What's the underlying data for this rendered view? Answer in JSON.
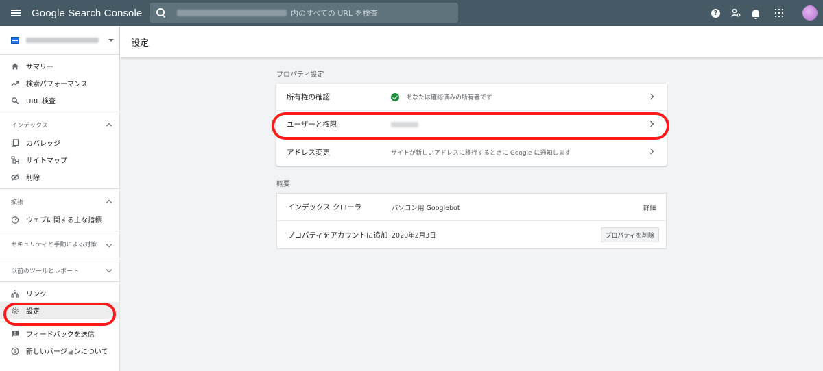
{
  "app": {
    "title": "Google Search Console",
    "search_hint": "内のすべての URL を検査",
    "help_label": "?"
  },
  "sidebar": {
    "main_items": [
      {
        "icon": "home-icon",
        "label": "サマリー"
      },
      {
        "icon": "trending-up-icon",
        "label": "検索パフォーマンス"
      },
      {
        "icon": "search-icon",
        "label": "URL 検査"
      }
    ],
    "index_section": {
      "title": "インデックス",
      "items": [
        {
          "icon": "coverage-icon",
          "label": "カバレッジ"
        },
        {
          "icon": "sitemap-icon",
          "label": "サイトマップ"
        },
        {
          "icon": "removal-icon",
          "label": "削除"
        }
      ]
    },
    "enhancement_section": {
      "title": "拡張",
      "items": [
        {
          "icon": "speedometer-icon",
          "label": "ウェブに関する主な指標"
        }
      ]
    },
    "security_section": {
      "title": "セキュリティと手動による対策"
    },
    "legacy_section": {
      "title": "以前のツールとレポート"
    },
    "tool_items": [
      {
        "icon": "links-icon",
        "label": "リンク"
      },
      {
        "icon": "gear-icon",
        "label": "設定"
      }
    ],
    "footer_items": [
      {
        "icon": "feedback-icon",
        "label": "フィードバックを送信"
      },
      {
        "icon": "info-icon",
        "label": "新しいバージョンについて"
      }
    ]
  },
  "page": {
    "title": "設定",
    "property_settings": {
      "title": "プロパティ設定",
      "rows": [
        {
          "label": "所有権の確認",
          "value": "あなたは確認済みの所有者です"
        },
        {
          "label": "ユーザーと権限",
          "value": ""
        },
        {
          "label": "アドレス変更",
          "value": "サイトが新しいアドレスに移行するときに Google に通知します"
        }
      ]
    },
    "overview": {
      "title": "概要",
      "rows": [
        {
          "label": "インデックス クローラ",
          "value": "パソコン用 Googlebot",
          "action": "詳細"
        },
        {
          "label": "プロパティをアカウントに追加",
          "value": "2020年2月3日",
          "action": "プロパティを削除"
        }
      ]
    }
  },
  "colors": {
    "topbar": "#455a64",
    "highlight_ring": "#ff1a1a",
    "verified": "#1e8e3e"
  }
}
